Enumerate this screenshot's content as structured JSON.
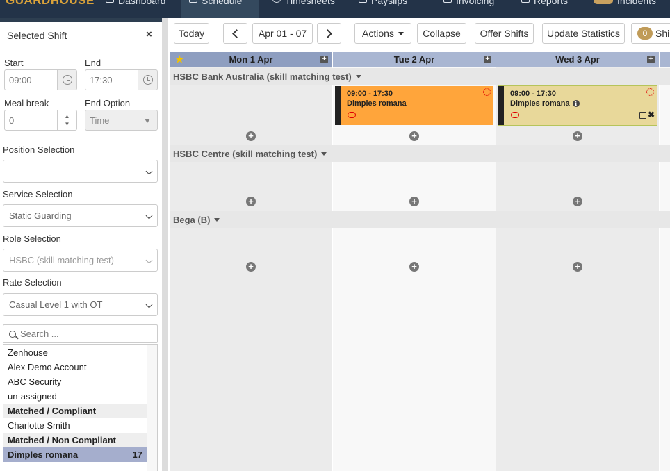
{
  "nav": {
    "brand": "GUARDHOUSE",
    "items": [
      {
        "label": "Dashboard"
      },
      {
        "label": "Schedule"
      },
      {
        "label": "Timesheets"
      },
      {
        "label": "Payslips"
      },
      {
        "label": "Invoicing"
      },
      {
        "label": "Reports"
      },
      {
        "label": "Incidents"
      }
    ]
  },
  "panel": {
    "title": "Selected Shift",
    "close": "×",
    "start_label": "Start",
    "start_value": "09:00",
    "end_label": "End",
    "end_value": "17:30",
    "meal_label": "Meal break",
    "meal_value": "0",
    "end_option_label": "End Option",
    "end_option_value": "Time",
    "position_label": "Position Selection",
    "position_value": "",
    "service_label": "Service Selection",
    "service_value": "Static Guarding",
    "role_label": "Role Selection",
    "role_value": "HSBC (skill matching test)",
    "rate_label": "Rate Selection",
    "rate_value": "Casual Level 1 with OT",
    "search_placeholder": "Search ...",
    "list": [
      {
        "label": "Zenhouse",
        "type": "item"
      },
      {
        "label": "Alex Demo Account",
        "type": "item"
      },
      {
        "label": "ABC Security",
        "type": "item"
      },
      {
        "label": "un-assigned",
        "type": "item"
      },
      {
        "label": "Matched / Compliant",
        "type": "group"
      },
      {
        "label": "Charlotte Smith",
        "type": "item"
      },
      {
        "label": "Matched / Non Compliant",
        "type": "group"
      },
      {
        "label": "Dimples romana",
        "type": "selected",
        "count": "17"
      }
    ]
  },
  "toolbar": {
    "today": "Today",
    "range": "Apr 01 - 07",
    "actions": "Actions",
    "collapse": "Collapse",
    "offer": "Offer Shifts",
    "update": "Update Statistics",
    "shifts_count": "0",
    "shifts_label": "Shi"
  },
  "days": [
    "Mon 1 Apr",
    "Tue 2 Apr",
    "Wed 3 Apr"
  ],
  "sites": [
    {
      "name": "HSBC Bank Australia (skill matching test)"
    },
    {
      "name": "HSBC Centre (skill matching test)"
    },
    {
      "name": "Bega (B)"
    }
  ],
  "shifts": [
    {
      "time": "09:00 - 17:30",
      "employee": "Dimples romana",
      "day": "Tue 2 Apr",
      "color": "#ffa53b"
    },
    {
      "time": "09:00 - 17:30",
      "employee": "Dimples romana",
      "day": "Wed 3 Apr",
      "color": "#e8d89a"
    }
  ],
  "colors": {
    "nav_bg": "#233348",
    "header_bg": "#a9b6d2",
    "selected_row": "#a5aecd",
    "orange_shift": "#ffa53b",
    "tan_shift": "#e8d89a"
  }
}
